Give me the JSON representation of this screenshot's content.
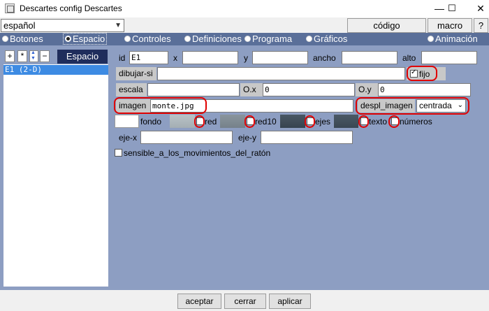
{
  "window": {
    "title": "Descartes config Descartes",
    "minimize": "—",
    "maximize": "☐",
    "close": "✕"
  },
  "top": {
    "language": "español",
    "code_btn": "código",
    "macro_btn": "macro",
    "help_btn": "?"
  },
  "tabs": [
    {
      "label": "Botones"
    },
    {
      "label": "Espacio"
    },
    {
      "label": "Controles"
    },
    {
      "label": "Definiciones"
    },
    {
      "label": "Programa"
    },
    {
      "label": "Gráficos"
    },
    {
      "label": "Animación"
    }
  ],
  "left": {
    "btn_add": "+",
    "btn_star": "*",
    "btn_up": "▲",
    "btn_down": "▼",
    "btn_minus": "−",
    "title": "Espacio",
    "items": [
      "E1 (2-D)"
    ]
  },
  "form": {
    "id_label": "id",
    "id_value": "E1",
    "x_label": "x",
    "x_value": "",
    "y_label": "y",
    "y_value": "",
    "ancho_label": "ancho",
    "ancho_value": "",
    "alto_label": "alto",
    "alto_value": "",
    "dibujar_label": "dibujar-si",
    "dibujar_value": "",
    "fijo_label": "fijo",
    "fijo_checked": true,
    "escala_label": "escala",
    "escala_value": "",
    "ox_label": "O.x",
    "ox_value": "0",
    "oy_label": "O.y",
    "oy_value": "0",
    "imagen_label": "imagen",
    "imagen_value": "monte.jpg",
    "despl_label": "despl_imagen",
    "despl_value": "centrada",
    "fondo_label": "fondo",
    "red_label": "red",
    "red10_label": "red10",
    "ejes_label": "ejes",
    "texto_label": "texto",
    "numeros_label": "números",
    "ejex_label": "eje-x",
    "ejex_value": "",
    "ejey_label": "eje-y",
    "ejey_value": "",
    "sensible_label": "sensible_a_los_movimientos_del_ratón"
  },
  "colors": {
    "fondo": "#ffffff",
    "red": "#a9b3b8",
    "red10": "#7a8690",
    "ejes": "#3d4a56",
    "texto": "#3f4d58",
    "panel": "#8d9ec2",
    "accent": "#e00000"
  },
  "bottom": {
    "aceptar": "aceptar",
    "cerrar": "cerrar",
    "aplicar": "aplicar"
  }
}
